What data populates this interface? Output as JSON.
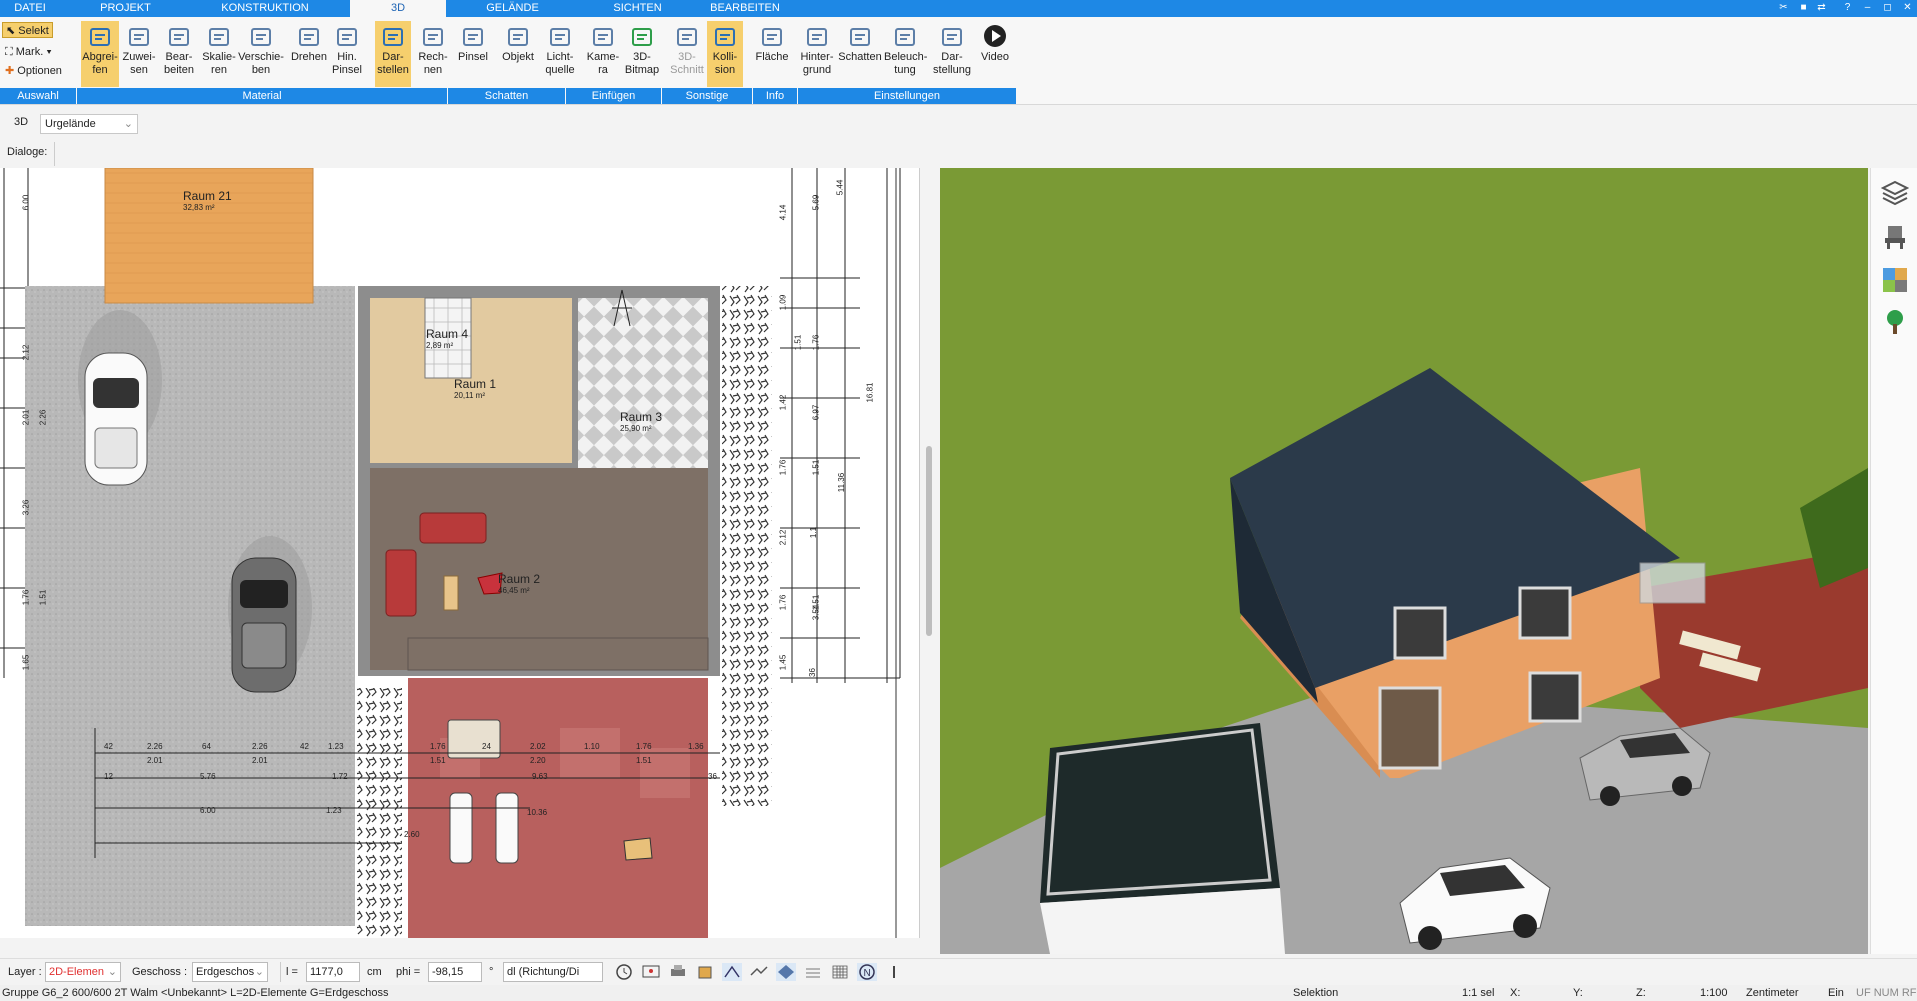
{
  "menu": {
    "tabs": [
      "DATEI",
      "PROJEKT",
      "KONSTRUKTION",
      "3D",
      "GELÄNDE",
      "SICHTEN",
      "BEARBEITEN"
    ],
    "active": "3D"
  },
  "ribbon": {
    "auswahl": {
      "selekt": "Selekt",
      "mark": "Mark.",
      "optionen": "Optionen",
      "group": "Auswahl"
    },
    "buttons": [
      {
        "label": "Abgrei-\nfen",
        "icon": "eyedropper-icon",
        "active": true
      },
      {
        "label": "Zuwei-\nsen",
        "icon": "assign-icon"
      },
      {
        "label": "Bear-\nbeiten",
        "icon": "edit-material-icon"
      },
      {
        "label": "Skalie-\nren",
        "icon": "scale-icon"
      },
      {
        "label": "Verschie-\nben",
        "icon": "move-icon"
      },
      {
        "label": "Drehen",
        "icon": "rotate-icon"
      },
      {
        "label": "Hin.\nPinsel",
        "icon": "brush-icon"
      },
      {
        "label": "Dar-\nstellen",
        "icon": "shadow-display-icon",
        "active": true
      },
      {
        "label": "Rech-\nnen",
        "icon": "shadow-calc-icon"
      },
      {
        "label": "Pinsel",
        "icon": "shadow-brush-icon"
      },
      {
        "label": "Objekt",
        "icon": "chair-icon"
      },
      {
        "label": "Licht-\nquelle",
        "icon": "lightbulb-icon"
      },
      {
        "label": "Kame-\nra",
        "icon": "camera-icon"
      },
      {
        "label": "3D-\nBitmap",
        "icon": "tree-icon"
      },
      {
        "label": "3D-\nSchnitt",
        "icon": "section-icon",
        "disabled": true
      },
      {
        "label": "Kolli-\nsion",
        "icon": "collision-icon",
        "active": true
      },
      {
        "label": "Fläche",
        "icon": "area-info-icon"
      },
      {
        "label": "Hinter-\ngrund",
        "icon": "background-icon"
      },
      {
        "label": "Schatten",
        "icon": "house-shadow-icon"
      },
      {
        "label": "Beleuch-\ntung",
        "icon": "lighting-icon"
      },
      {
        "label": "Dar-\nstellung",
        "icon": "monitor-icon"
      },
      {
        "label": "Video",
        "icon": "play-icon"
      }
    ],
    "groups": [
      "Material",
      "Schatten",
      "Einfügen",
      "Sonstige",
      "Info",
      "Einstellungen"
    ]
  },
  "bar3d": {
    "label": "3D",
    "dropdown": "Urgelände"
  },
  "dialog": {
    "label": "Dialoge:"
  },
  "plan": {
    "rooms": [
      {
        "name": "Raum 21",
        "area": "32,83 m²"
      },
      {
        "name": "Raum 4",
        "area": "2,89 m²"
      },
      {
        "name": "Raum 1",
        "area": "20,11 m²"
      },
      {
        "name": "Raum 3",
        "area": "25,90 m²"
      },
      {
        "name": "Raum 2",
        "area": "46,45 m²"
      }
    ],
    "dims_left": [
      "6.00",
      "2.12",
      "2.01",
      "2.26",
      "3.26",
      "1.76",
      "1.51",
      "1.65"
    ],
    "dims_right_a": [
      "4.14",
      "1.09",
      "1.51",
      "1.42",
      "1.76",
      "2.12",
      "1.76",
      "1.45"
    ],
    "dims_right_b": [
      "5.69",
      "1.76",
      "6.97",
      "1.51",
      "1.1",
      "1.51",
      "3.54",
      "36"
    ],
    "dims_right_c": [
      "5.44",
      "11.36",
      "16.81"
    ],
    "dims_bottom_1": [
      "42",
      "2.26",
      "64",
      "2.26",
      "42",
      "1.23"
    ],
    "dims_bottom_1b": [
      "2.01",
      "2.01"
    ],
    "dims_bottom_2": [
      "1.76",
      "24",
      "2.02",
      "1.10",
      "1.76",
      "1.36"
    ],
    "dims_bottom_2b": [
      "1.51",
      "2.20",
      "1.51"
    ],
    "dims_bottom_3": [
      "12",
      "5.76",
      "1.72",
      "9.63",
      "36"
    ],
    "dims_bottom_4": [
      "6.00",
      "1.23",
      "10.36"
    ],
    "dims_bottom_5": [
      "2.60"
    ]
  },
  "bottom": {
    "layer_label": "Layer :",
    "layer_value": "2D-Elemen",
    "geschoss_label": "Geschoss :",
    "geschoss_value": "Erdgeschos",
    "l_label": "l =",
    "l_value": "1177,0",
    "l_unit": "cm",
    "phi_label": "phi =",
    "phi_value": "-98,15",
    "phi_unit": "°",
    "dl_value": "dl (Richtung/Di"
  },
  "status": {
    "left": "Gruppe G6_2 600/600 2T Walm <Unbekannt> L=2D-Elemente G=Erdgeschoss",
    "selektion": "Selektion",
    "sel": "1:1 sel",
    "x": "X:",
    "y": "Y:",
    "z": "Z:",
    "scale": "1:100",
    "unit": "Zentimeter",
    "ein": "Ein",
    "flags": "UF NUM RF"
  },
  "colors": {
    "accent": "#1e88e5",
    "active": "#f6cf6d",
    "grass": "#7a9a35",
    "roof": "#2b3a4a",
    "wall": "#e9a065"
  }
}
